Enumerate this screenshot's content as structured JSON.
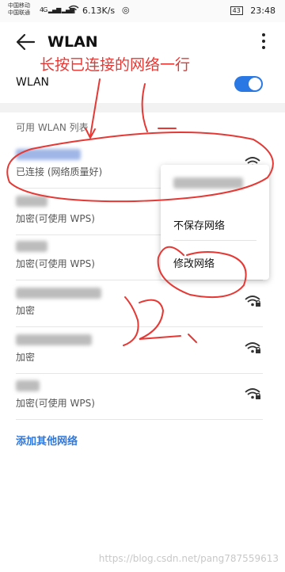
{
  "status_bar": {
    "carrier_1": "中国移动",
    "carrier_2": "中国联通",
    "net_type": "4G",
    "speed": "6.13K/s",
    "battery": "43",
    "time": "23:48"
  },
  "app_bar": {
    "title": "WLAN",
    "back_icon": "back-arrow-icon",
    "menu_icon": "more-vert-icon"
  },
  "wlan_toggle": {
    "label": "WLAN",
    "on": true,
    "accent": "#2a78e4"
  },
  "section_title": "可用 WLAN 列表",
  "networks": [
    {
      "status": "已连接 (网络质量好)",
      "secured": false,
      "name_color": "#9fb6e6"
    },
    {
      "status": "加密(可使用 WPS)",
      "secured": true,
      "name_color": "#bcbcbc"
    },
    {
      "status": "加密(可使用 WPS)",
      "secured": true,
      "name_color": "#bcbcbc"
    },
    {
      "status": "加密",
      "secured": true,
      "name_color": "#bcbcbc"
    },
    {
      "status": "加密",
      "secured": true,
      "name_color": "#bcbcbc"
    },
    {
      "status": "加密(可使用 WPS)",
      "secured": true,
      "name_color": "#bcbcbc"
    }
  ],
  "add_other": "添加其他网络",
  "context_menu": {
    "items": [
      "不保存网络",
      "修改网络"
    ]
  },
  "annotation": {
    "text": "长按已连接的网络一行",
    "color": "#e53935"
  },
  "watermark": "https://blog.csdn.net/pang787559613"
}
